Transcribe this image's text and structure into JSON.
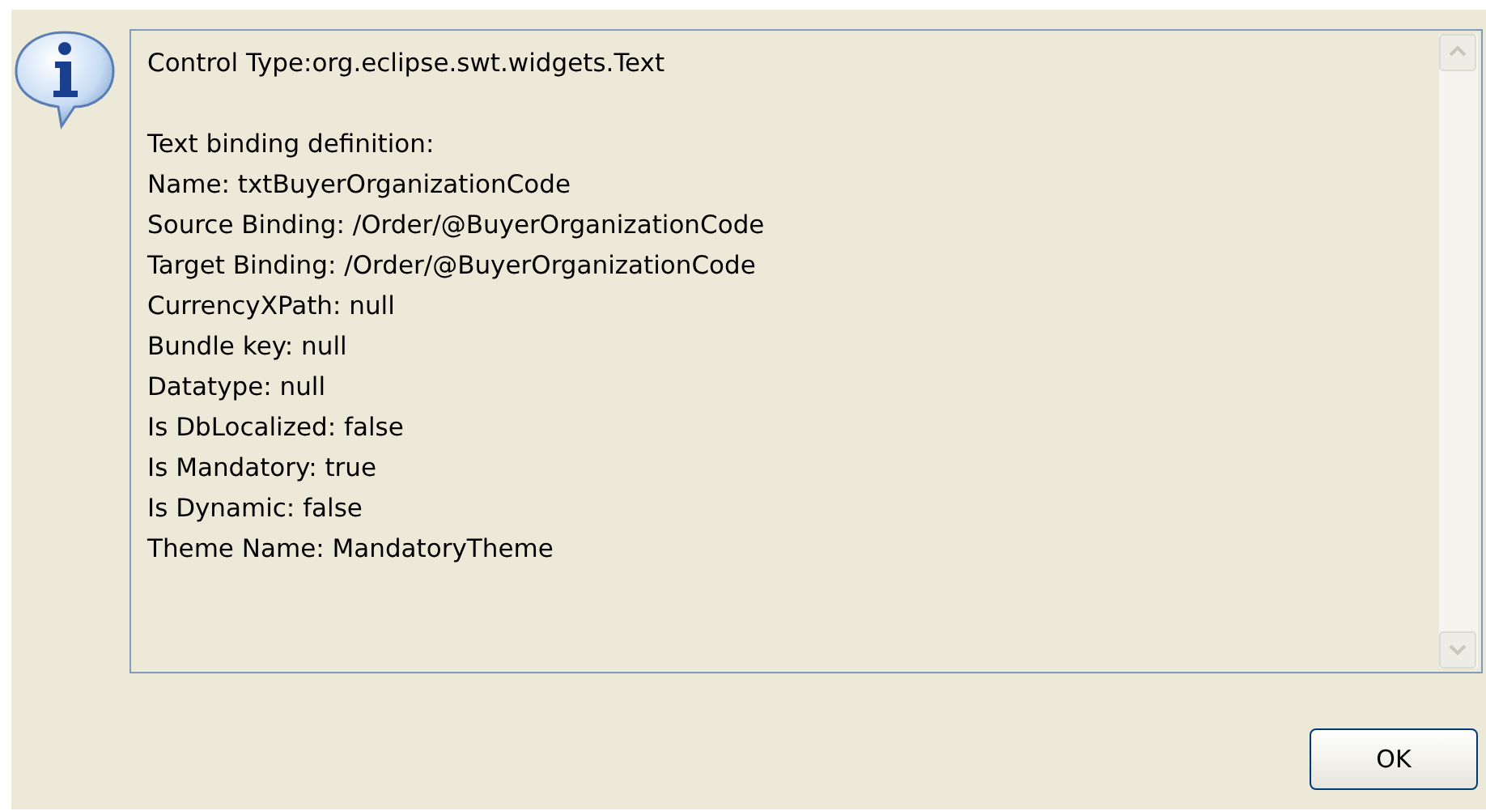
{
  "message": {
    "header": "Control Type:org.eclipse.swt.widgets.Text",
    "lines": [
      "Text binding definition:",
      "Name: txtBuyerOrganizationCode",
      "Source Binding: /Order/@BuyerOrganizationCode",
      "Target Binding: /Order/@BuyerOrganizationCode",
      "CurrencyXPath: null",
      "Bundle key: null",
      "Datatype: null",
      "Is DbLocalized: false",
      "Is Mandatory: true",
      "Is Dynamic: false",
      "Theme Name: MandatoryTheme"
    ]
  },
  "buttons": [
    "OK"
  ]
}
